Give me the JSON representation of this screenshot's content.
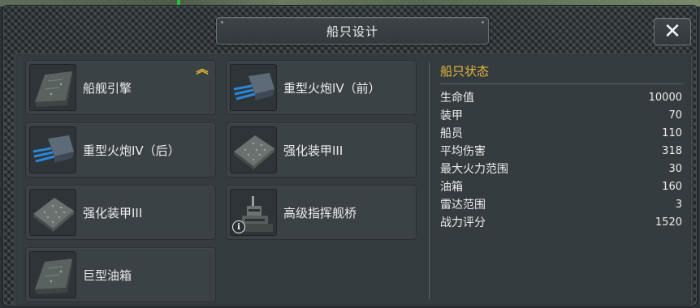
{
  "window": {
    "title": "船只设计",
    "close_glyph": "✕"
  },
  "parts": [
    {
      "label": "船舰引擎",
      "icon": "armor-plate-icon",
      "upgrade_available": true
    },
    {
      "label": "重型火炮IV（前）",
      "icon": "heavy-cannon-icon"
    },
    {
      "label": "重型火炮IV（后）",
      "icon": "heavy-cannon-icon"
    },
    {
      "label": "强化装甲III",
      "icon": "riveted-armor-icon"
    },
    {
      "label": "强化装甲III",
      "icon": "riveted-armor-icon"
    },
    {
      "label": "高级指挥舰桥",
      "icon": "command-bridge-icon",
      "info_badge": "i"
    },
    {
      "label": "巨型油箱",
      "icon": "armor-plate-icon"
    }
  ],
  "upgrade_glyph": "︽",
  "stats": {
    "title": "船只状态",
    "rows": [
      {
        "name": "生命值",
        "value": "10000"
      },
      {
        "name": "装甲",
        "value": "70"
      },
      {
        "name": "船员",
        "value": "110"
      },
      {
        "name": "平均伤害",
        "value": "318"
      },
      {
        "name": "最大火力范围",
        "value": "30"
      },
      {
        "name": "油箱",
        "value": "160"
      },
      {
        "name": "雷达范围",
        "value": "3"
      },
      {
        "name": "战力评分",
        "value": "1520"
      }
    ]
  },
  "colors": {
    "accent_gold": "#e4b83a",
    "panel": "#353c40",
    "card": "#3b4246"
  }
}
